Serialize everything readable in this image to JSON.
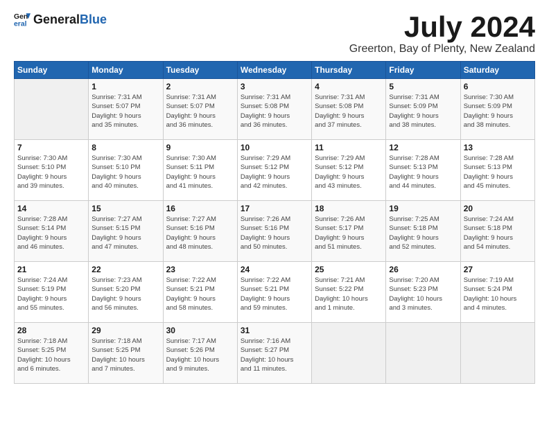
{
  "logo": {
    "text_general": "General",
    "text_blue": "Blue"
  },
  "title": "July 2024",
  "location": "Greerton, Bay of Plenty, New Zealand",
  "days_of_week": [
    "Sunday",
    "Monday",
    "Tuesday",
    "Wednesday",
    "Thursday",
    "Friday",
    "Saturday"
  ],
  "weeks": [
    [
      {
        "day": "",
        "info": ""
      },
      {
        "day": "1",
        "info": "Sunrise: 7:31 AM\nSunset: 5:07 PM\nDaylight: 9 hours\nand 35 minutes."
      },
      {
        "day": "2",
        "info": "Sunrise: 7:31 AM\nSunset: 5:07 PM\nDaylight: 9 hours\nand 36 minutes."
      },
      {
        "day": "3",
        "info": "Sunrise: 7:31 AM\nSunset: 5:08 PM\nDaylight: 9 hours\nand 36 minutes."
      },
      {
        "day": "4",
        "info": "Sunrise: 7:31 AM\nSunset: 5:08 PM\nDaylight: 9 hours\nand 37 minutes."
      },
      {
        "day": "5",
        "info": "Sunrise: 7:31 AM\nSunset: 5:09 PM\nDaylight: 9 hours\nand 38 minutes."
      },
      {
        "day": "6",
        "info": "Sunrise: 7:30 AM\nSunset: 5:09 PM\nDaylight: 9 hours\nand 38 minutes."
      }
    ],
    [
      {
        "day": "7",
        "info": "Sunrise: 7:30 AM\nSunset: 5:10 PM\nDaylight: 9 hours\nand 39 minutes."
      },
      {
        "day": "8",
        "info": "Sunrise: 7:30 AM\nSunset: 5:10 PM\nDaylight: 9 hours\nand 40 minutes."
      },
      {
        "day": "9",
        "info": "Sunrise: 7:30 AM\nSunset: 5:11 PM\nDaylight: 9 hours\nand 41 minutes."
      },
      {
        "day": "10",
        "info": "Sunrise: 7:29 AM\nSunset: 5:12 PM\nDaylight: 9 hours\nand 42 minutes."
      },
      {
        "day": "11",
        "info": "Sunrise: 7:29 AM\nSunset: 5:12 PM\nDaylight: 9 hours\nand 43 minutes."
      },
      {
        "day": "12",
        "info": "Sunrise: 7:28 AM\nSunset: 5:13 PM\nDaylight: 9 hours\nand 44 minutes."
      },
      {
        "day": "13",
        "info": "Sunrise: 7:28 AM\nSunset: 5:13 PM\nDaylight: 9 hours\nand 45 minutes."
      }
    ],
    [
      {
        "day": "14",
        "info": "Sunrise: 7:28 AM\nSunset: 5:14 PM\nDaylight: 9 hours\nand 46 minutes."
      },
      {
        "day": "15",
        "info": "Sunrise: 7:27 AM\nSunset: 5:15 PM\nDaylight: 9 hours\nand 47 minutes."
      },
      {
        "day": "16",
        "info": "Sunrise: 7:27 AM\nSunset: 5:16 PM\nDaylight: 9 hours\nand 48 minutes."
      },
      {
        "day": "17",
        "info": "Sunrise: 7:26 AM\nSunset: 5:16 PM\nDaylight: 9 hours\nand 50 minutes."
      },
      {
        "day": "18",
        "info": "Sunrise: 7:26 AM\nSunset: 5:17 PM\nDaylight: 9 hours\nand 51 minutes."
      },
      {
        "day": "19",
        "info": "Sunrise: 7:25 AM\nSunset: 5:18 PM\nDaylight: 9 hours\nand 52 minutes."
      },
      {
        "day": "20",
        "info": "Sunrise: 7:24 AM\nSunset: 5:18 PM\nDaylight: 9 hours\nand 54 minutes."
      }
    ],
    [
      {
        "day": "21",
        "info": "Sunrise: 7:24 AM\nSunset: 5:19 PM\nDaylight: 9 hours\nand 55 minutes."
      },
      {
        "day": "22",
        "info": "Sunrise: 7:23 AM\nSunset: 5:20 PM\nDaylight: 9 hours\nand 56 minutes."
      },
      {
        "day": "23",
        "info": "Sunrise: 7:22 AM\nSunset: 5:21 PM\nDaylight: 9 hours\nand 58 minutes."
      },
      {
        "day": "24",
        "info": "Sunrise: 7:22 AM\nSunset: 5:21 PM\nDaylight: 9 hours\nand 59 minutes."
      },
      {
        "day": "25",
        "info": "Sunrise: 7:21 AM\nSunset: 5:22 PM\nDaylight: 10 hours\nand 1 minute."
      },
      {
        "day": "26",
        "info": "Sunrise: 7:20 AM\nSunset: 5:23 PM\nDaylight: 10 hours\nand 3 minutes."
      },
      {
        "day": "27",
        "info": "Sunrise: 7:19 AM\nSunset: 5:24 PM\nDaylight: 10 hours\nand 4 minutes."
      }
    ],
    [
      {
        "day": "28",
        "info": "Sunrise: 7:18 AM\nSunset: 5:25 PM\nDaylight: 10 hours\nand 6 minutes."
      },
      {
        "day": "29",
        "info": "Sunrise: 7:18 AM\nSunset: 5:25 PM\nDaylight: 10 hours\nand 7 minutes."
      },
      {
        "day": "30",
        "info": "Sunrise: 7:17 AM\nSunset: 5:26 PM\nDaylight: 10 hours\nand 9 minutes."
      },
      {
        "day": "31",
        "info": "Sunrise: 7:16 AM\nSunset: 5:27 PM\nDaylight: 10 hours\nand 11 minutes."
      },
      {
        "day": "",
        "info": ""
      },
      {
        "day": "",
        "info": ""
      },
      {
        "day": "",
        "info": ""
      }
    ]
  ]
}
